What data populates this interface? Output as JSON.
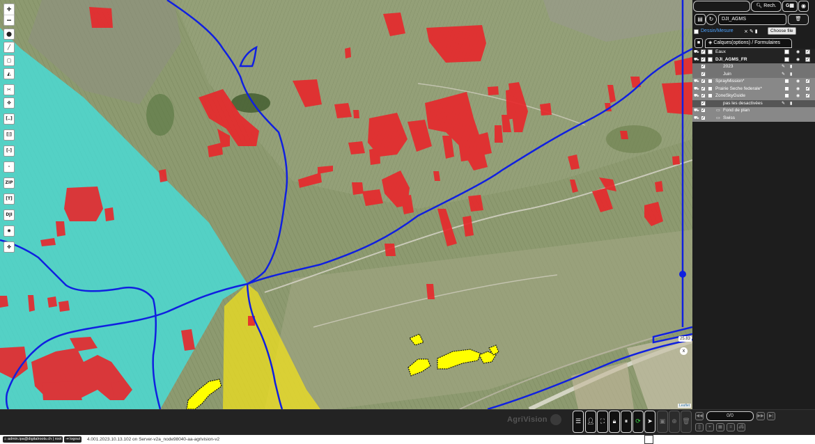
{
  "map": {
    "zoom_in": "+",
    "zoom_out": "−",
    "tools": [
      {
        "name": "marker-tool",
        "icon": "map-pin-icon",
        "glyph": "⬤",
        "kind": "glyph"
      },
      {
        "name": "line-tool",
        "icon": "line-icon",
        "glyph": "╱",
        "kind": "glyph"
      },
      {
        "name": "rectangle-tool",
        "icon": "rectangle-icon",
        "glyph": "▢",
        "kind": "glyph"
      },
      {
        "name": "polygon-tool",
        "icon": "polygon-icon",
        "glyph": "◭",
        "kind": "glyph"
      },
      {
        "name": "cut-tool",
        "icon": "cut-icon",
        "glyph": "✂",
        "kind": "glyph"
      },
      {
        "name": "move-tool",
        "icon": "move-icon",
        "glyph": "✥",
        "kind": "glyph"
      },
      {
        "name": "bracket-tool",
        "icon": "bracket-icon",
        "glyph": "[‥]",
        "kind": "text"
      },
      {
        "name": "split-tool",
        "icon": "split-icon",
        "glyph": "[|]",
        "kind": "text"
      },
      {
        "name": "minus-bracket-tool",
        "icon": "minus-bracket-icon",
        "glyph": "[-]",
        "kind": "text"
      },
      {
        "name": "dash-tool",
        "icon": "dash-icon",
        "glyph": "-",
        "kind": "text"
      },
      {
        "name": "zip-tool",
        "icon": "zip-icon",
        "glyph": "ZIP",
        "kind": "text"
      },
      {
        "name": "t-bracket-tool",
        "icon": "t-bracket-icon",
        "glyph": "[T]",
        "kind": "text"
      },
      {
        "name": "dji-tool",
        "icon": "dji-icon",
        "glyph": "DJI",
        "kind": "text"
      },
      {
        "name": "sun-tool",
        "icon": "sun-icon",
        "glyph": "✹",
        "kind": "glyph"
      },
      {
        "name": "drone-tool",
        "icon": "drone-icon",
        "glyph": "✤",
        "kind": "glyph"
      }
    ],
    "scale_label": "25.83",
    "scale_close": "x",
    "attribution": "Leaflet"
  },
  "panel": {
    "search_placeholder": "",
    "rech_label": "Rech.",
    "g_label": "G",
    "project_value": "DJI_AGMS",
    "dessin_label": "Dessin/Mesure",
    "choose_file": "Choose file",
    "calques_tab": "Calques(options) / Formulaires",
    "layers": [
      {
        "name": "Eaux",
        "style": "l-dark",
        "type": "main",
        "bold": false
      },
      {
        "name": "DJI_AGMS_FR",
        "style": "l-dark",
        "type": "main",
        "bold": true
      },
      {
        "name": "2023",
        "style": "l-grey",
        "type": "sub"
      },
      {
        "name": "Juin",
        "style": "l-grey",
        "type": "sub"
      },
      {
        "name": "SprayMission*",
        "style": "l-lightgrey",
        "type": "main",
        "bold": false
      },
      {
        "name": "Prairie Seche federale*",
        "style": "l-lightgrey",
        "type": "main",
        "bold": false
      },
      {
        "name": "ZoneSkyGuide",
        "style": "l-lightgrey",
        "type": "main",
        "bold": false
      },
      {
        "name": "pas les desactivées",
        "style": "l-header",
        "type": "sub"
      },
      {
        "name": "Fond de plan",
        "style": "l-lightgrey",
        "type": "base"
      },
      {
        "name": "Swiss",
        "style": "l-lightgrey",
        "type": "base"
      }
    ]
  },
  "bottombar": {
    "brand": "AgriVision",
    "counter": "0/0"
  },
  "status": {
    "user": "admin.ipa@digitalroots.ch | root",
    "logout": "logout",
    "version": "4.001.2023.10.13.102 on Server-v2a_node98040-aa-agrivision-v2"
  },
  "colors": {
    "parcel": "#e8272b",
    "route": "#1020e0",
    "cyan_zone": "#3fe6e6",
    "yellow_zone": "#f2e21a",
    "yellow_parcel": "#ffff00"
  }
}
